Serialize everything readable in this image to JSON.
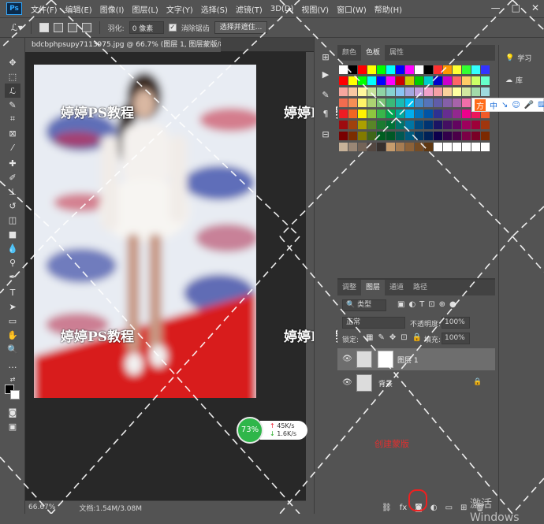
{
  "menubar": {
    "logo": "Ps",
    "items": [
      "文件(F)",
      "编辑(E)",
      "图像(I)",
      "图层(L)",
      "文字(Y)",
      "选择(S)",
      "滤镜(T)",
      "3D(D)",
      "视图(V)",
      "窗口(W)",
      "帮助(H)"
    ],
    "window_controls": [
      "—",
      "□",
      "✕"
    ]
  },
  "options": {
    "feather_label": "羽化:",
    "feather_value": "0 像素",
    "antialias_label": "消除锯齿",
    "select_mask_label": "选择并遮住..."
  },
  "document": {
    "tab_title": "bdcbphpsupy7113975.jpg @ 66.7% (图层 1, 图层蒙版/8) *",
    "zoom": "66.67%",
    "doc_info": "文档:1.54M/3.08M"
  },
  "watermark": {
    "text": "婷婷PS教程"
  },
  "swatches_panel": {
    "tabs": [
      "颜色",
      "色板",
      "属性"
    ],
    "active_tab": "色板",
    "colors": [
      "#ffffff",
      "#000000",
      "#ff0000",
      "#ffff00",
      "#00ff00",
      "#00ffff",
      "#0000ff",
      "#ff00ff",
      "#ffffff",
      "#000000",
      "#ff3030",
      "#ff9900",
      "#ffff33",
      "#33ff33",
      "#33ffff",
      "#3333ff",
      "#ff0000",
      "#ffff00",
      "#00ff00",
      "#00ffff",
      "#0000ff",
      "#ff00ff",
      "#cc0000",
      "#cccc00",
      "#00cc00",
      "#00cccc",
      "#0000cc",
      "#cc00cc",
      "#ff6666",
      "#ffcc66",
      "#ccff66",
      "#66ffcc",
      "#f7a69e",
      "#f9c7a2",
      "#fff79c",
      "#c5e19a",
      "#8fd3a4",
      "#86d2d0",
      "#89c4f4",
      "#a4a7e0",
      "#c5a1dd",
      "#f0a1c9",
      "#f4a0a5",
      "#fbd29c",
      "#ffffa1",
      "#d2e8a0",
      "#a2dbaa",
      "#9ddbe0",
      "#f26c4f",
      "#f68e55",
      "#fff467",
      "#acd372",
      "#7cc576",
      "#3bb878",
      "#1abbb4",
      "#00bff3",
      "#438ccb",
      "#5574b9",
      "#605ca8",
      "#855fa8",
      "#a763a9",
      "#f06ea9",
      "#f26d7d",
      "#f7977a",
      "#ed1c24",
      "#f26522",
      "#fff200",
      "#8dc63f",
      "#39b54a",
      "#00a651",
      "#00a99d",
      "#00aeef",
      "#0072bc",
      "#0054a6",
      "#2e3192",
      "#662d91",
      "#92278f",
      "#ec008c",
      "#ed145b",
      "#f15a29",
      "#9e0b0f",
      "#a0410d",
      "#aba000",
      "#598527",
      "#1a7b30",
      "#007236",
      "#00746b",
      "#0076a3",
      "#004b80",
      "#003471",
      "#1b1464",
      "#440e62",
      "#630460",
      "#9e005d",
      "#9e0039",
      "#a0360d",
      "#790000",
      "#7b2e00",
      "#827b00",
      "#406618",
      "#005e20",
      "#005826",
      "#005952",
      "#005b7f",
      "#003663",
      "#002157",
      "#0d004c",
      "#32004b",
      "#4b0049",
      "#7b0046",
      "#7a0026",
      "#7c2900",
      "#c7b299",
      "#998675",
      "#736357",
      "#534741",
      "#37302d",
      "#c69c6d",
      "#a67c52",
      "#8c6239",
      "#754c24",
      "#603913",
      "#ffffff",
      "#ffffff",
      "#ffffff",
      "#ffffff",
      "#ffffff",
      "#ffffff"
    ]
  },
  "layers_panel": {
    "tabs": [
      "调整",
      "图层",
      "通道",
      "路径"
    ],
    "active_tab": "图层",
    "filter_kind": "类型",
    "blend_mode": "正常",
    "opacity_label": "不透明度:",
    "opacity_value": "100%",
    "lock_label": "锁定:",
    "fill_label": "填充:",
    "fill_value": "100%",
    "layers": [
      {
        "name": "图层 1",
        "selected": true,
        "has_mask": true
      },
      {
        "name": "背景",
        "selected": false,
        "locked": true
      }
    ]
  },
  "right_strip": {
    "items": [
      "学习",
      "库"
    ]
  },
  "ime_bar": {
    "items": [
      "方",
      "中",
      "↘",
      "☺",
      "🎤",
      "⌨",
      "👕"
    ]
  },
  "net_widget": {
    "percent": "73%",
    "up": "45K/s",
    "down": "1.6K/s"
  },
  "annotation": {
    "text": "创建蒙版"
  },
  "activation": {
    "text": "激活 Windows"
  }
}
